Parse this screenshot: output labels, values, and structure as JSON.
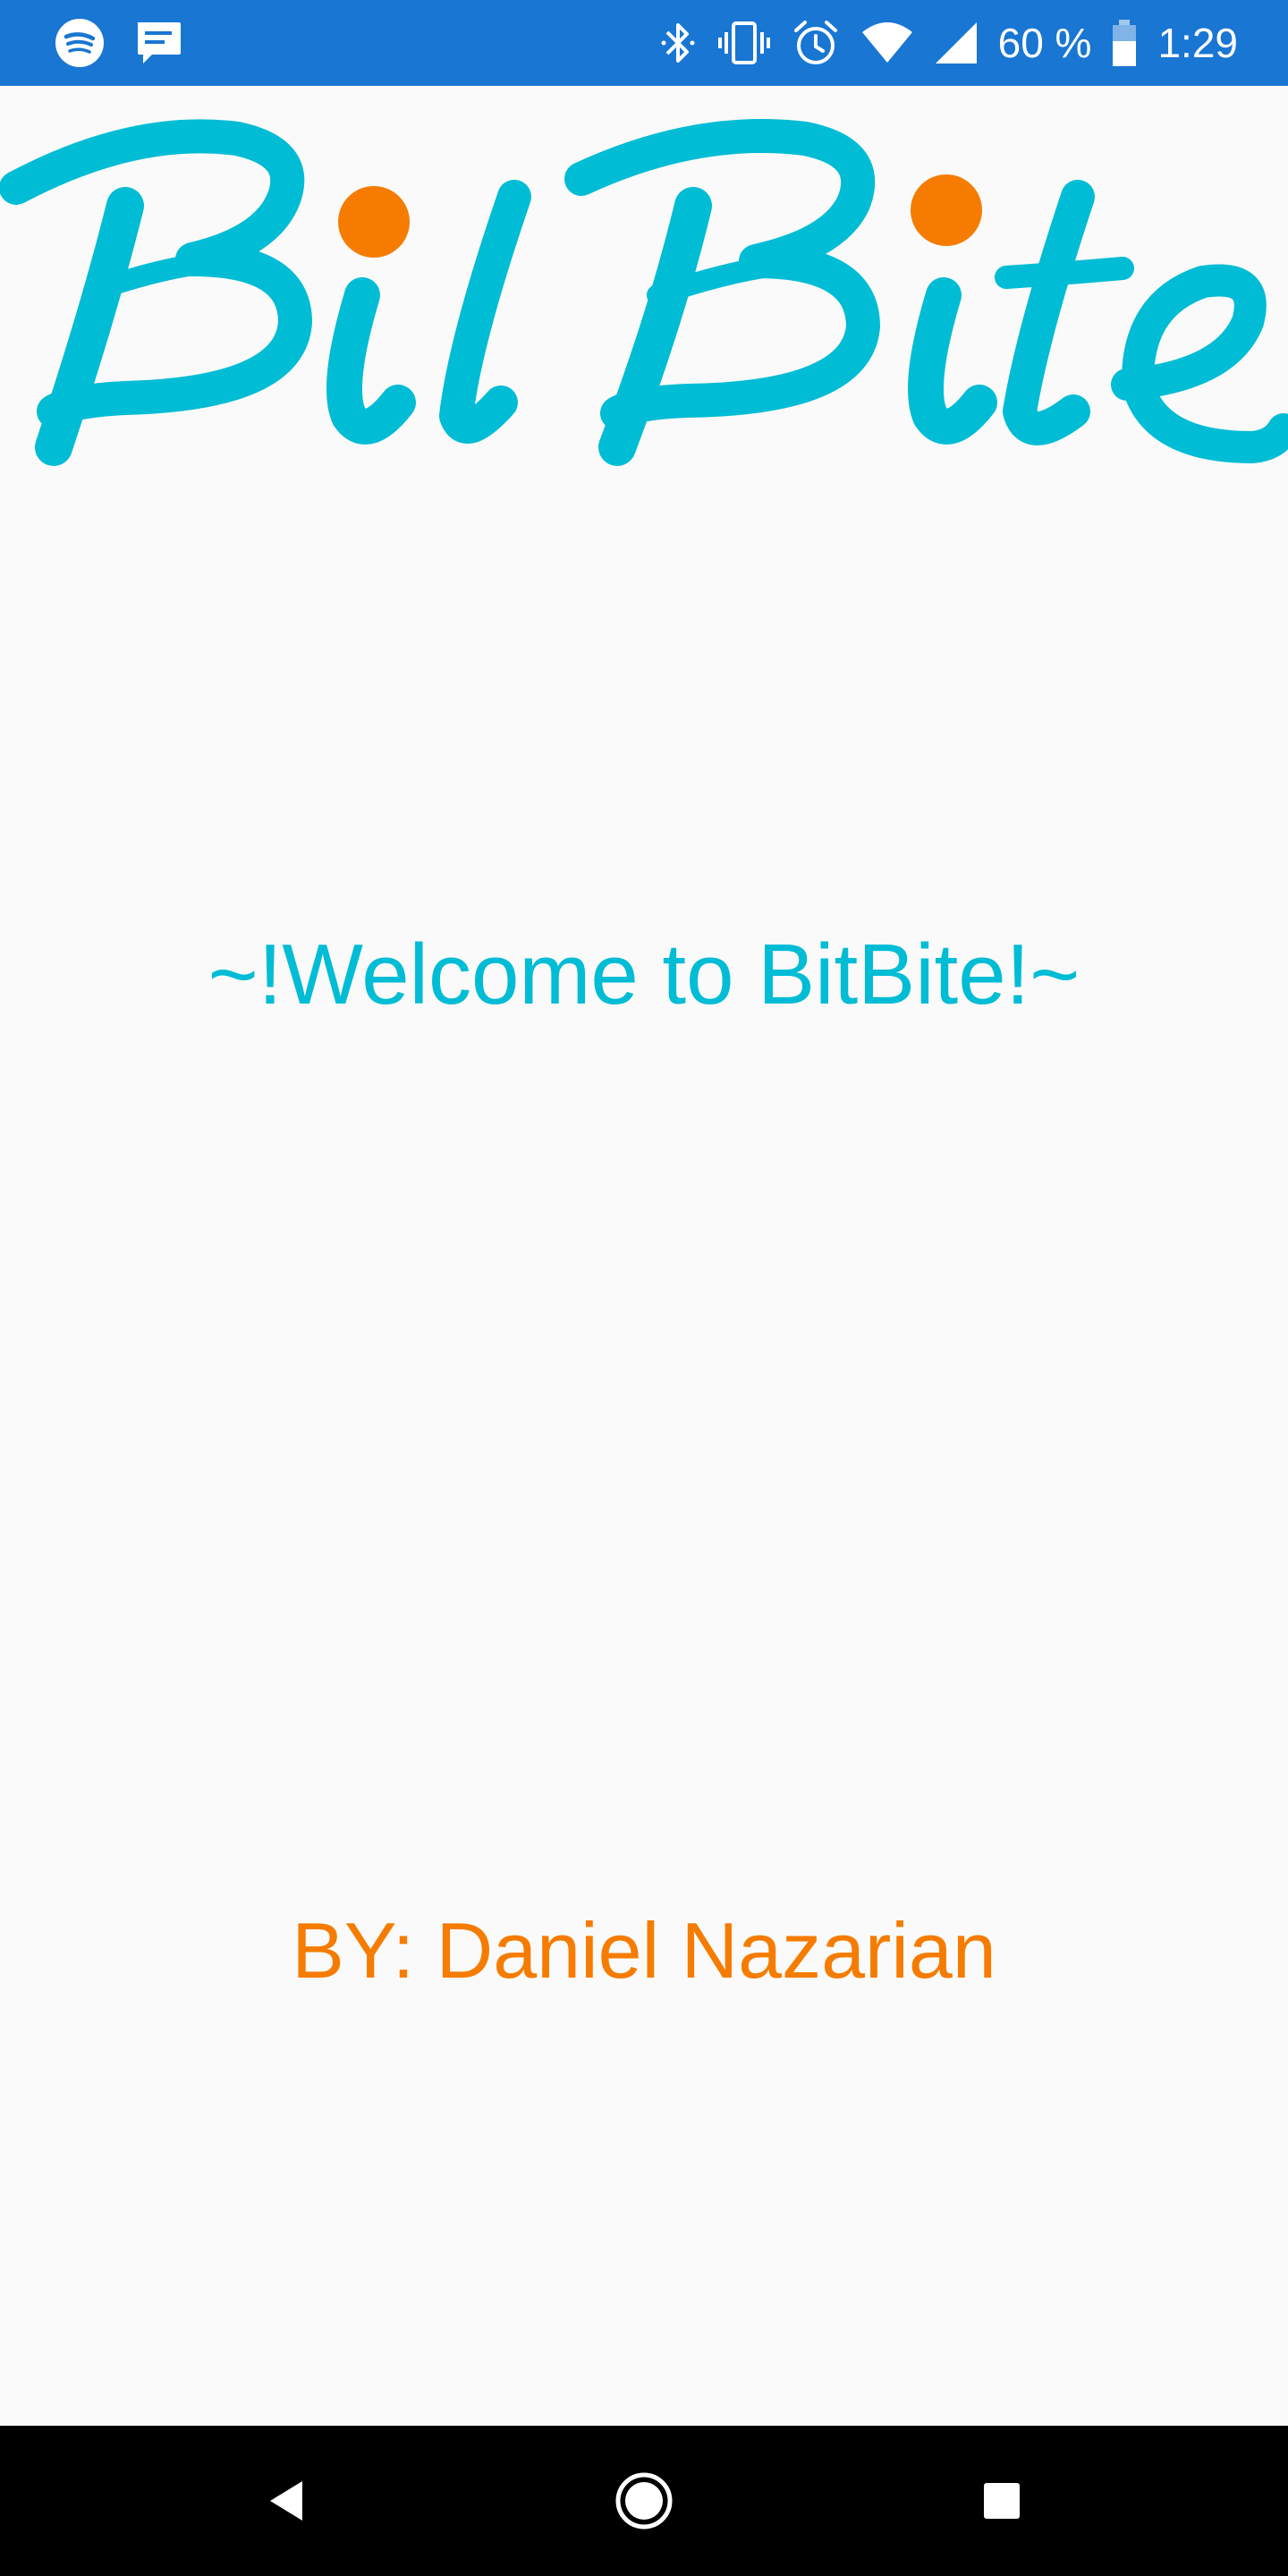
{
  "status_bar": {
    "battery_text": "60 %",
    "time": "1:29",
    "left_icons": [
      "spotify-icon",
      "message-icon"
    ],
    "right_icons": [
      "bluetooth-icon",
      "vibrate-icon",
      "alarm-icon",
      "wifi-icon",
      "signal-icon",
      "battery-icon"
    ]
  },
  "logo": {
    "text": "BitBite",
    "color": "#00bcd4",
    "dot_color": "#f57c00"
  },
  "welcome": {
    "text": "~!Welcome to BitBite!~",
    "color": "#00bcd4"
  },
  "author": {
    "text": "BY: Daniel Nazarian",
    "color": "#f57c00"
  },
  "nav_bar": {
    "buttons": [
      "back",
      "home",
      "recents"
    ]
  },
  "colors": {
    "status_bar": "#1976d2",
    "background": "#fafafa",
    "nav_bar": "#000000"
  }
}
